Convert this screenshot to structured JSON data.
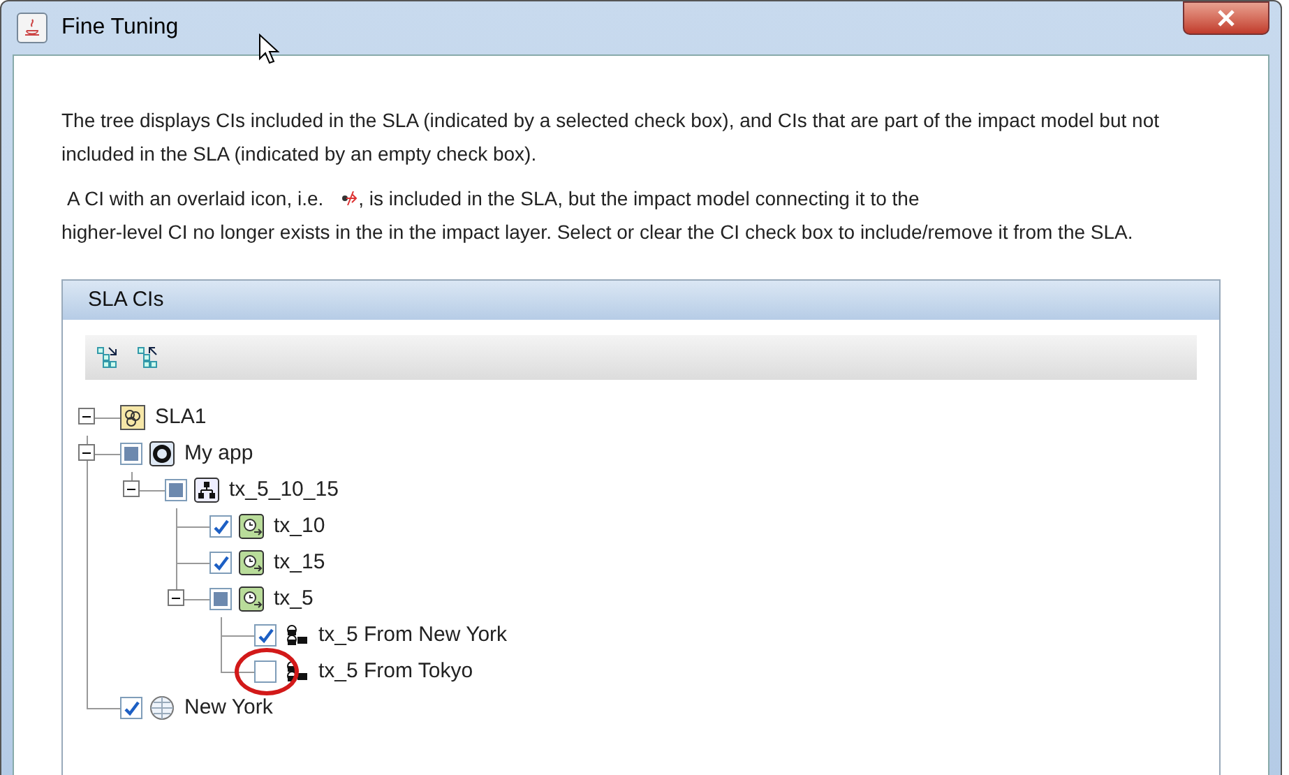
{
  "window": {
    "title": "Fine Tuning"
  },
  "description": "The tree displays CIs included in the SLA (indicated by a selected check box), and CIs that are part of the impact model but not included in the SLA (indicated by an empty check box).",
  "note": {
    "before_icon": "A CI with an overlaid icon, i.e.",
    "after_icon": ", is included in the SLA, but the impact model connecting it to the",
    "continuation": "higher-level CI no longer exists in the in the impact layer. Select or clear the CI check box to include/remove it from the SLA."
  },
  "panel": {
    "title": "SLA CIs",
    "tree": [
      {
        "label": "SLA1",
        "kind": "sla",
        "expanded": true,
        "children": [
          {
            "label": "My app",
            "kind": "application",
            "checked": false,
            "partial": true,
            "expanded": true,
            "children": [
              {
                "label": "tx_5_10_15",
                "kind": "transaction_group",
                "checked": false,
                "partial": true,
                "expanded": true,
                "children": [
                  {
                    "label": "tx_10",
                    "kind": "transaction",
                    "checked": true
                  },
                  {
                    "label": "tx_15",
                    "kind": "transaction",
                    "checked": true
                  },
                  {
                    "label": "tx_5",
                    "kind": "transaction",
                    "checked": false,
                    "partial": true,
                    "expanded": true,
                    "children": [
                      {
                        "label": "tx_5 From New York",
                        "kind": "location_pair",
                        "checked": true,
                        "highlighted": false
                      },
                      {
                        "label": "tx_5 From Tokyo",
                        "kind": "location_pair",
                        "checked": false,
                        "partial": false,
                        "highlighted": true
                      }
                    ]
                  }
                ]
              }
            ]
          },
          {
            "label": "New York",
            "kind": "location",
            "checked": true
          }
        ]
      }
    ]
  }
}
